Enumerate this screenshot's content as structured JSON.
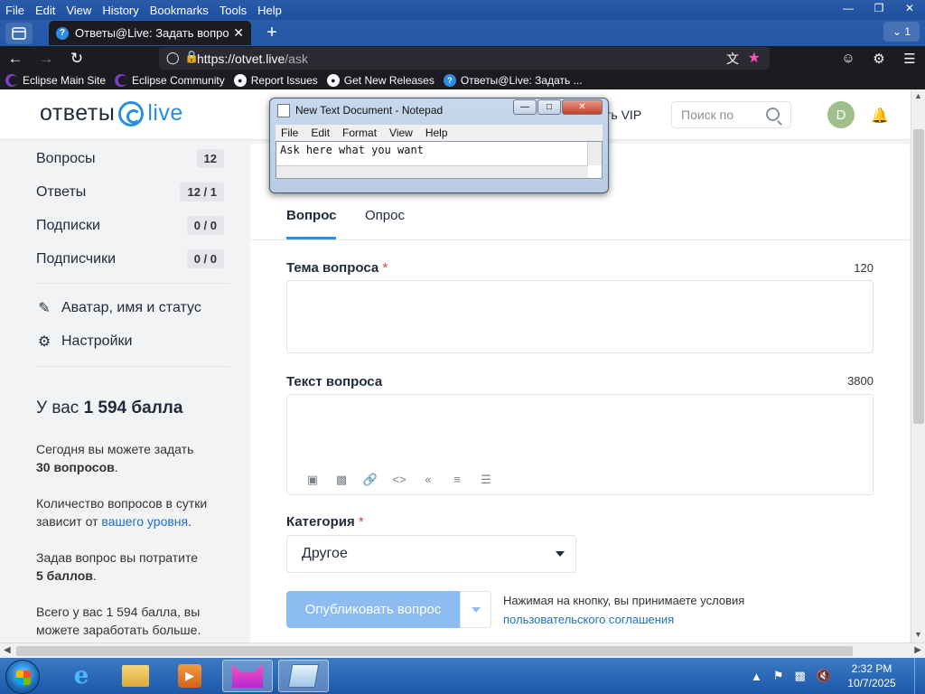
{
  "browser": {
    "menu": [
      "File",
      "Edit",
      "View",
      "History",
      "Bookmarks",
      "Tools",
      "Help"
    ],
    "tab_title": "Ответы@Live: Задать вопрос",
    "tab_count": "1",
    "url_host": "https://otvet.live",
    "url_path": "/ask",
    "bookmarks": [
      "Eclipse Main Site",
      "Eclipse Community",
      "Report Issues",
      "Get New Releases",
      "Ответы@Live: Задать ..."
    ]
  },
  "site": {
    "logo_text": "ответы",
    "logo_live": "live",
    "vip_label": "ть VIP",
    "search_placeholder": "Поиск по  ",
    "avatar_initial": "D"
  },
  "sidebar": {
    "stats": [
      {
        "label": "Вопросы",
        "value": "12"
      },
      {
        "label": "Ответы",
        "value": "12 / 1"
      },
      {
        "label": "Подписки",
        "value": "0 / 0"
      },
      {
        "label": "Подписчики",
        "value": "0 / 0"
      }
    ],
    "profile_link": "Аватар, имя и статус",
    "settings_link": "Настройки",
    "score_prefix": "У вас ",
    "score_value": "1 594 балла",
    "today_text": "Сегодня вы можете задать",
    "today_bold": "30 вопросов",
    "daily_text": "Количество вопросов в сутки зависит от ",
    "daily_link": "вашего уровня",
    "cost_text": "Задав вопрос вы потратите",
    "cost_bold": "5 баллов",
    "total_text": "Всего у вас 1 594 балла, вы можете заработать больше."
  },
  "form": {
    "tab_question": "Вопрос",
    "tab_poll": "Опрос",
    "topic_label": "Тема вопроса",
    "topic_limit": "120",
    "text_label": "Текст вопроса",
    "text_limit": "3800",
    "category_label": "Категория",
    "category_value": "Другое",
    "publish_button": "Опубликовать вопрос",
    "terms_text": "Нажимая на кнопку, вы принимаете условия",
    "terms_link": "пользовательского соглашения"
  },
  "notepad": {
    "title": "New Text Document - Notepad",
    "menu": [
      "File",
      "Edit",
      "Format",
      "View",
      "Help"
    ],
    "content": "Ask here what you want"
  },
  "taskbar": {
    "time": "2:32 PM",
    "date": "10/7/2025"
  }
}
